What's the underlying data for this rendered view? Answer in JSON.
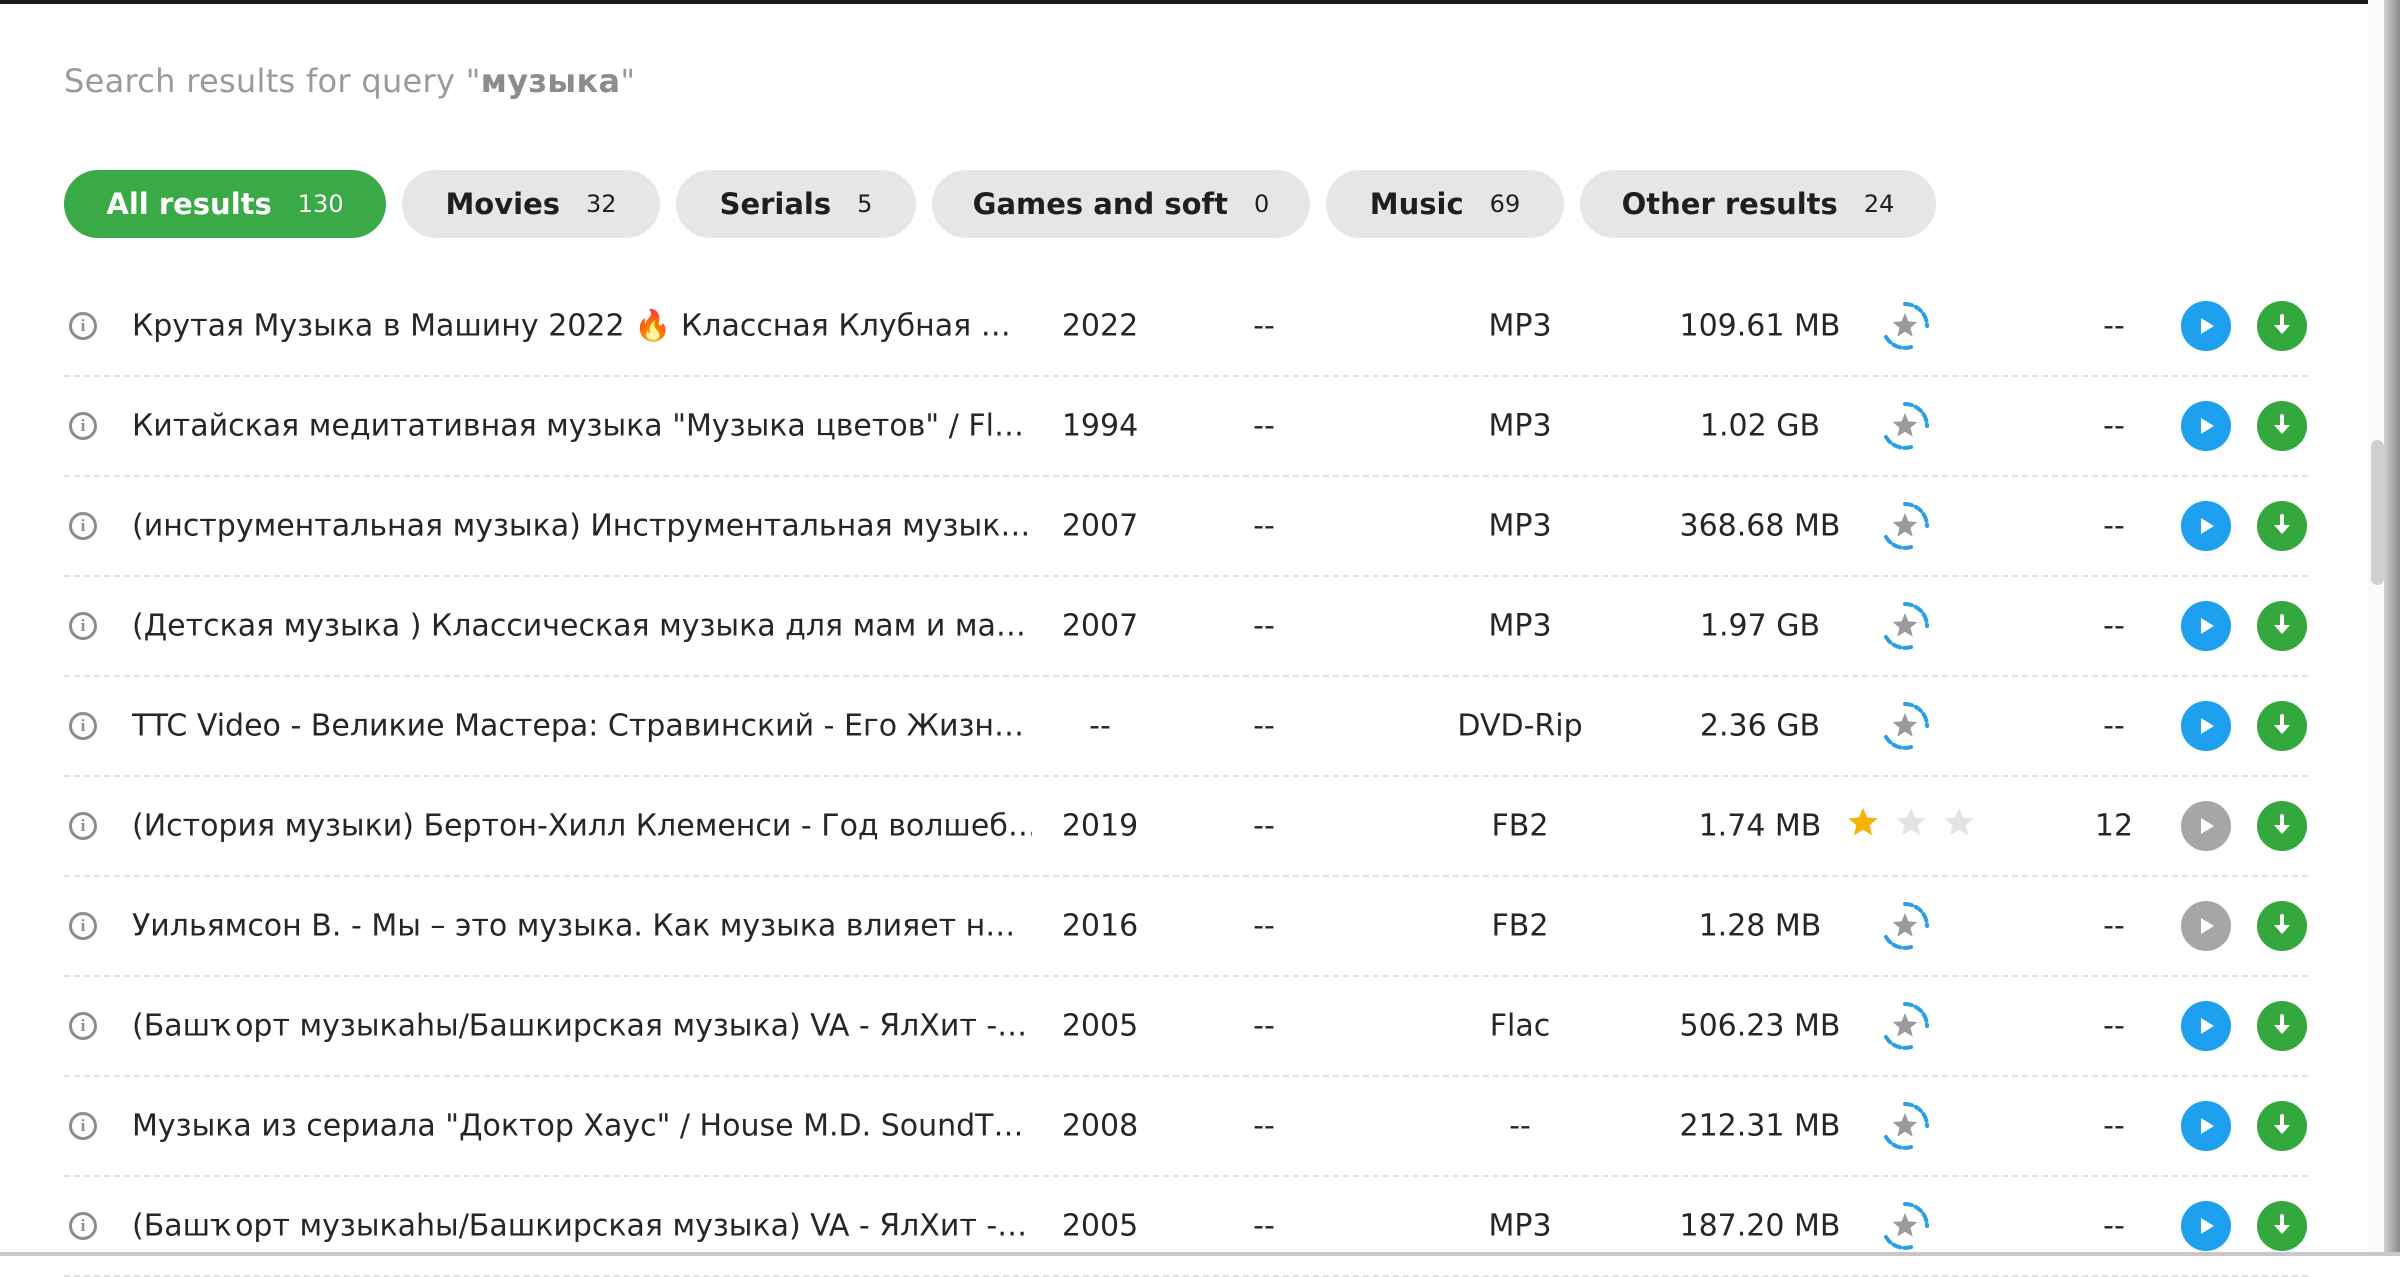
{
  "search": {
    "prefix": "Search results for query \"",
    "query": "музыка",
    "suffix": "\""
  },
  "tabs": [
    {
      "label": "All results",
      "count": "130",
      "active": true
    },
    {
      "label": "Movies",
      "count": "32",
      "active": false
    },
    {
      "label": "Serials",
      "count": "5",
      "active": false
    },
    {
      "label": "Games and soft",
      "count": "0",
      "active": false
    },
    {
      "label": "Music",
      "count": "69",
      "active": false
    },
    {
      "label": "Other results",
      "count": "24",
      "active": false
    }
  ],
  "results": [
    {
      "title": "Крутая Музыка в Машину 2022 🔥 Классная Клубная …",
      "year": "2022",
      "col3": "--",
      "format": "MP3",
      "size": "109.61 MB",
      "rating": "loading",
      "count": "--",
      "play_enabled": true
    },
    {
      "title": "Китайская медитативная музыка \"Музыка цветов\" / Fl…",
      "year": "1994",
      "col3": "--",
      "format": "MP3",
      "size": "1.02 GB",
      "rating": "loading",
      "count": "--",
      "play_enabled": true
    },
    {
      "title": "(инструментальная музыка) Инструментальная музык…",
      "year": "2007",
      "col3": "--",
      "format": "MP3",
      "size": "368.68 MB",
      "rating": "loading",
      "count": "--",
      "play_enabled": true
    },
    {
      "title": "(Детская музыка ) Классическая музыка для мам и ма…",
      "year": "2007",
      "col3": "--",
      "format": "MP3",
      "size": "1.97 GB",
      "rating": "loading",
      "count": "--",
      "play_enabled": true
    },
    {
      "title": "TTC Video - Великие Мастера: Стравинский - Его Жизн…",
      "year": "--",
      "col3": "--",
      "format": "DVD-Rip",
      "size": "2.36 GB",
      "rating": "loading",
      "count": "--",
      "play_enabled": true
    },
    {
      "title": "(История музыки) Бертон-Хилл Клеменси - Год волшеб…",
      "year": "2019",
      "col3": "--",
      "format": "FB2",
      "size": "1.74 MB",
      "rating": 1,
      "count": "12",
      "play_enabled": false
    },
    {
      "title": "Уильямсон В. - Мы – это музыка. Как музыка влияет н…",
      "year": "2016",
      "col3": "--",
      "format": "FB2",
      "size": "1.28 MB",
      "rating": "loading",
      "count": "--",
      "play_enabled": false
    },
    {
      "title": "(Башҡорт музыкаhы/Башкирская музыка) VA - ЯлХит -…",
      "year": "2005",
      "col3": "--",
      "format": "Flac",
      "size": "506.23 MB",
      "rating": "loading",
      "count": "--",
      "play_enabled": true
    },
    {
      "title": "Музыка из сериала \"Доктор Хаус\" / House M.D. SoundT…",
      "year": "2008",
      "col3": "--",
      "format": "--",
      "size": "212.31 MB",
      "rating": "loading",
      "count": "--",
      "play_enabled": true
    },
    {
      "title": "(Башҡорт музыкаhы/Башкирская музыка) VA - ЯлХит -…",
      "year": "2005",
      "col3": "--",
      "format": "MP3",
      "size": "187.20 MB",
      "rating": "loading",
      "count": "--",
      "play_enabled": true
    }
  ],
  "icons": {
    "info": "info-icon",
    "play": "play-icon",
    "download": "download-icon",
    "rating_loading": "rating-loading-icon",
    "star": "star-icon"
  },
  "colors": {
    "active_tab": "#3aaa46",
    "play": "#1e9ff0",
    "play_disabled": "#a6a6a6",
    "download": "#34a83d",
    "star_filled": "#f5b400",
    "star_empty": "#e3e3e3"
  }
}
